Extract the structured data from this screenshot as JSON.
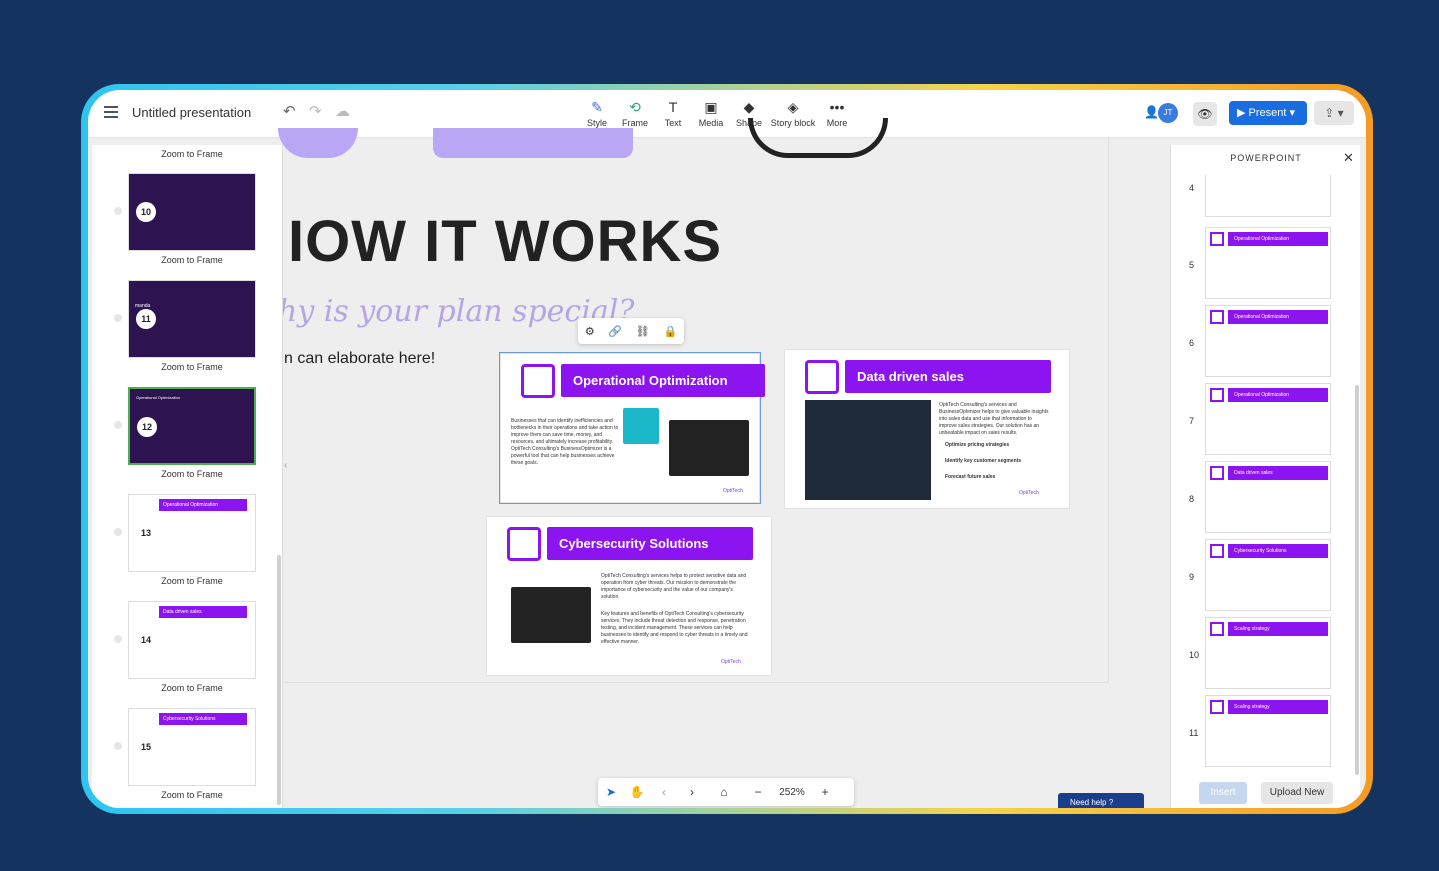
{
  "app": {
    "title": "Untitled presentation"
  },
  "toolbar": {
    "tools": [
      {
        "label": "Style",
        "icon": "pen-icon"
      },
      {
        "label": "Frame",
        "icon": "frame-icon"
      },
      {
        "label": "Text",
        "icon": "text-icon"
      },
      {
        "label": "Media",
        "icon": "media-icon"
      },
      {
        "label": "Shape",
        "icon": "shape-icon"
      },
      {
        "label": "Story block",
        "icon": "layers-icon"
      },
      {
        "label": "More",
        "icon": "more-icon"
      }
    ],
    "avatar_initials": "JT",
    "present_label": "Present"
  },
  "canvas": {
    "heading": "IOW IT WORKS",
    "subheading": "hy is your plan special?",
    "elaborate": "n can elaborate here!",
    "cards": [
      {
        "title": "Operational Optimization",
        "body": "Businesses that can identify inefficiencies and bottlenecks in their operations and take action to improve them can save time, money, and resources, and ultimately increase profitability. OptiTech Consulting's BusinessOptimizer is a powerful tool that can help businesses achieve these goals.",
        "logo": "OptiTech"
      },
      {
        "title": "Data driven sales",
        "body": "OptiTech Consulting's services and BusinessOptimizer helps to give valuable insights into sales data and use that information to improve sales strategies. Our solution has an unbeatable impact on sales results.",
        "bullets": [
          "Optimize pricing strategies",
          "Identify key customer segments",
          "Forecast future sales"
        ],
        "logo": "OptiTech"
      },
      {
        "title": "Cybersecurity Solutions",
        "body": "OptiTech Consulting's services helps to protect sensitive data and operation from cyber threats. Our mission to demonstrate the importance of cybersecurity and the value of our company's solution.",
        "body2": "Key features and benefits of OptiTech Consulting's cybersecurity services. They include threat detection and response, penetration testing, and incident management. These services can help businesses to identify and respond to cyber threats in a timely and effective manner.",
        "logo": "OptiTech"
      }
    ]
  },
  "left_panel": {
    "top_caption": "Zoom to Frame",
    "items": [
      {
        "num": "10",
        "caption": "Zoom to Frame"
      },
      {
        "num": "11",
        "caption": "Zoom to Frame",
        "name_text": "manda"
      },
      {
        "num": "12",
        "caption": "Zoom to Frame",
        "thumb_title": "Operational Optimization"
      },
      {
        "num": "13",
        "caption": "Zoom to Frame",
        "thumb_title": "Operational Optimization"
      },
      {
        "num": "14",
        "caption": "Zoom to Frame",
        "thumb_title": "Data driven sales"
      },
      {
        "num": "15",
        "caption": "Zoom to Frame",
        "thumb_title": "Cybersecurity Solutions"
      }
    ]
  },
  "right_panel": {
    "title": "POWERPOINT",
    "items": [
      {
        "num": "4",
        "thumb_title": ""
      },
      {
        "num": "5",
        "thumb_title": "Operational Optimization"
      },
      {
        "num": "6",
        "thumb_title": "Operational Optimization"
      },
      {
        "num": "7",
        "thumb_title": "Operational Optimization"
      },
      {
        "num": "8",
        "thumb_title": "Data driven sales"
      },
      {
        "num": "9",
        "thumb_title": "Cybersecurity Solutions"
      },
      {
        "num": "10",
        "thumb_title": "Scaling strategy"
      },
      {
        "num": "11",
        "thumb_title": "Scaling strategy"
      }
    ],
    "insert_label": "Insert",
    "upload_label": "Upload New"
  },
  "bottom_bar": {
    "zoom": "252%"
  },
  "help": {
    "label": "Need help"
  },
  "colors": {
    "background": "#14335e",
    "accent_purple": "#8c14f0",
    "present_blue": "#1a6de0"
  }
}
